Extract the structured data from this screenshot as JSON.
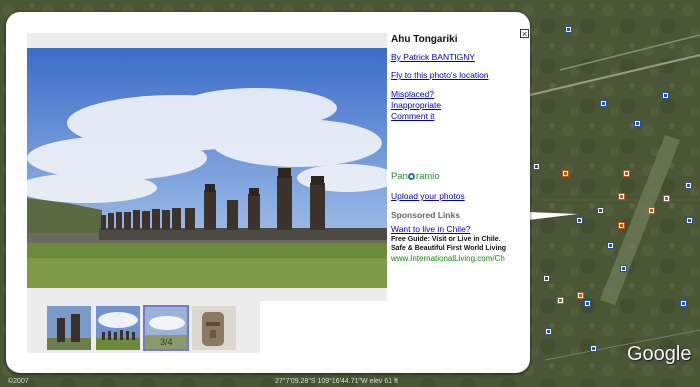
{
  "photo": {
    "title": "Ahu Tongariki",
    "author_link": "By Patrick BANTIGNY",
    "fly_link": "Fly to this photo's location",
    "report_links": [
      "Misplaced?",
      "Inappropriate",
      "Comment it"
    ]
  },
  "panoramio": {
    "logo_text": "Panoramio",
    "upload_link": "Upload your photos"
  },
  "sponsored": {
    "heading": "Sponsored Links",
    "ad_title": "Want to live in Chile?",
    "ad_line1": "Free Guide: Visit or Live in Chile.",
    "ad_line2": "Safe & Beautiful First World Living",
    "ad_url": "www.InternationalLiving.com/Ch"
  },
  "thumbnails": {
    "selected_index": 2,
    "caption": "3/4",
    "items": [
      "moai-closeup-thumb",
      "moai-row-thumb",
      "moai-sky-thumb",
      "moai-head-thumb"
    ]
  },
  "map": {
    "logo": "Google",
    "status_left": "©2007",
    "status_mid": "27°7'09.28\"S 109°16'44.71\"W elev 61 ft"
  },
  "colors": {
    "link": "#0000cc",
    "ad_url": "#118811",
    "panoramio": "#2e8b2e"
  }
}
